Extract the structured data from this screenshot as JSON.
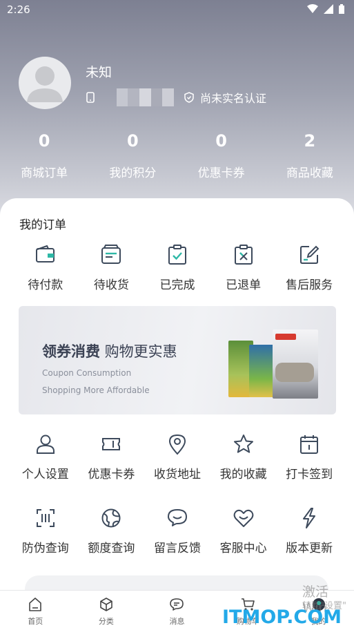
{
  "status_bar": {
    "time": "2:26",
    "icons": [
      "wifi-icon",
      "signal-icon",
      "battery-icon"
    ]
  },
  "profile": {
    "name": "未知",
    "verify_status": "尚未实名认证"
  },
  "stats": [
    {
      "value": "0",
      "label": "商城订单"
    },
    {
      "value": "0",
      "label": "我的积分"
    },
    {
      "value": "0",
      "label": "优惠卡券"
    },
    {
      "value": "2",
      "label": "商品收藏"
    }
  ],
  "orders": {
    "title": "我的订单",
    "items": [
      {
        "label": "待付款",
        "icon": "wallet-icon"
      },
      {
        "label": "待收货",
        "icon": "inbox-icon"
      },
      {
        "label": "已完成",
        "icon": "clipboard-check-icon"
      },
      {
        "label": "已退单",
        "icon": "clipboard-x-icon"
      },
      {
        "label": "售后服务",
        "icon": "edit-icon"
      }
    ]
  },
  "banner": {
    "title_bold": "领券消费",
    "title_rest": " 购物更实惠",
    "subtitle_1": "Coupon Consumption",
    "subtitle_2": "Shopping More Affordable"
  },
  "services_row1": [
    {
      "label": "个人设置",
      "icon": "user-icon"
    },
    {
      "label": "优惠卡券",
      "icon": "ticket-icon"
    },
    {
      "label": "收货地址",
      "icon": "location-pin-icon"
    },
    {
      "label": "我的收藏",
      "icon": "star-icon"
    },
    {
      "label": "打卡签到",
      "icon": "calendar-icon"
    }
  ],
  "services_row2": [
    {
      "label": "防伪查询",
      "icon": "barcode-icon"
    },
    {
      "label": "额度查询",
      "icon": "globe-icon"
    },
    {
      "label": "留言反馈",
      "icon": "chat-bubble-icon"
    },
    {
      "label": "客服中心",
      "icon": "heart-icon"
    },
    {
      "label": "版本更新",
      "icon": "lightning-icon"
    }
  ],
  "tabbar": [
    {
      "label": "首页",
      "icon": "home-icon"
    },
    {
      "label": "分类",
      "icon": "category-icon"
    },
    {
      "label": "消息",
      "icon": "message-icon"
    },
    {
      "label": "购物车",
      "icon": "cart-icon"
    },
    {
      "label": "我的",
      "icon": "profile-icon"
    }
  ],
  "watermark": {
    "activate": "激活 Win",
    "settings": "转到\"设置\"",
    "logo": "ITMOP.COM"
  },
  "colors": {
    "header_top": "#7d8092",
    "accent_icon": "#3d4a5c",
    "check_green": "#2eb8a6",
    "logo_blue": "#23a9e8"
  }
}
